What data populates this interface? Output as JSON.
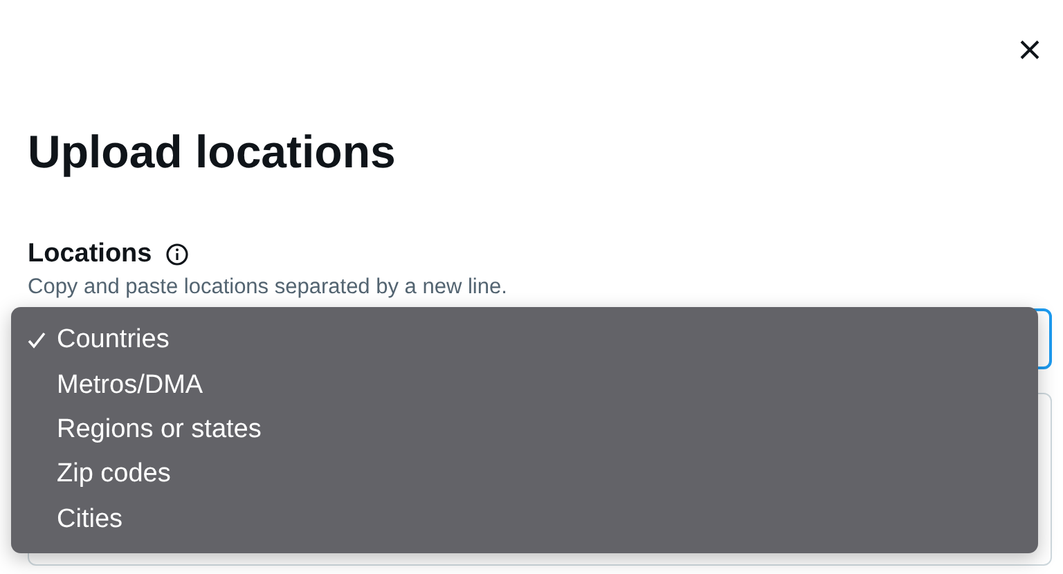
{
  "dialog": {
    "title": "Upload locations"
  },
  "field": {
    "label": "Locations",
    "hint": "Copy and paste locations separated by a new line."
  },
  "dropdown": {
    "options": [
      {
        "label": "Countries",
        "selected": true
      },
      {
        "label": "Metros/DMA",
        "selected": false
      },
      {
        "label": "Regions or states",
        "selected": false
      },
      {
        "label": "Zip codes",
        "selected": false
      },
      {
        "label": "Cities",
        "selected": false
      }
    ]
  }
}
